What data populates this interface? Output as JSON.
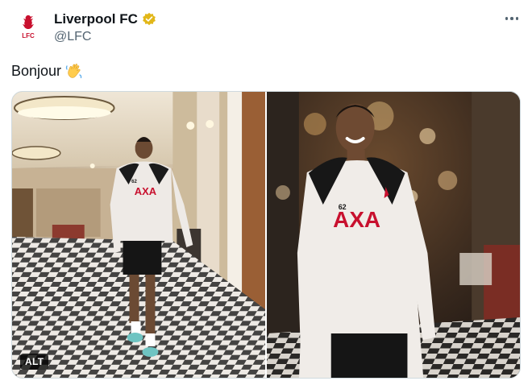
{
  "author": {
    "display_name": "Liverpool FC",
    "handle": "@LFC",
    "avatar_text": "LFC",
    "verified_color": "#e2b719"
  },
  "tweet": {
    "text": "Bonjour",
    "emoji": "waving-hand"
  },
  "media": {
    "photos": [
      {
        "shirt_sponsor": "AXA",
        "shirt_number": "62",
        "badge": "ALT"
      },
      {
        "shirt_sponsor": "AXA",
        "shirt_number": "62"
      }
    ]
  },
  "colors": {
    "lfc_red": "#c8102e",
    "text": "#0f1419",
    "secondary": "#536471"
  }
}
